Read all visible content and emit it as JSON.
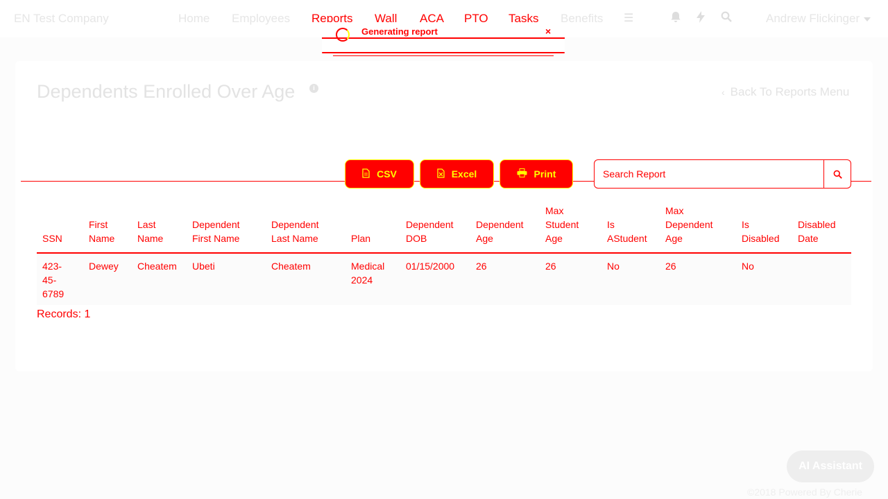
{
  "navbar": {
    "brand": "EN Test Company",
    "links": [
      {
        "label": "Home"
      },
      {
        "label": "Employees"
      },
      {
        "label": "Reports"
      },
      {
        "label": "Wall"
      },
      {
        "label": "ACA"
      },
      {
        "label": "PTO"
      },
      {
        "label": "Tasks"
      },
      {
        "label": "Benefits"
      }
    ],
    "icons": [
      "menu-icon",
      "bell-icon",
      "lightning-icon",
      "search-icon"
    ],
    "user_name": "Andrew Flickinger"
  },
  "toast": {
    "title": "Generating report",
    "close": "×"
  },
  "page": {
    "title": "Dependents Enrolled Over Age",
    "back_link": "Back To Reports Menu"
  },
  "toolbar": {
    "csv_label": "CSV",
    "excel_label": "Excel",
    "print_label": "Print",
    "search_placeholder": "Search Report"
  },
  "table": {
    "headers": [
      [
        "SSN"
      ],
      [
        "First",
        "Name"
      ],
      [
        "Last",
        "Name"
      ],
      [
        "Dependent",
        "First Name"
      ],
      [
        "Dependent",
        "Last Name"
      ],
      [
        "Plan"
      ],
      [
        "Dependent",
        "DOB"
      ],
      [
        "Dependent",
        "Age"
      ],
      [
        "Max",
        "Student",
        "Age"
      ],
      [
        "Is",
        "AStudent"
      ],
      [
        "Max",
        "Dependent",
        "Age"
      ],
      [
        "Is",
        "Disabled"
      ],
      [
        "Disabled",
        "Date"
      ]
    ],
    "rows": [
      {
        "ssn": [
          "423-",
          "45-",
          "6789"
        ],
        "first_name": "Dewey",
        "last_name": "Cheatem",
        "dependent_first_name": "Ubeti",
        "dependent_last_name": "Cheatem",
        "plan": [
          "Medical",
          "2024"
        ],
        "dependent_dob": "01/15/2000",
        "dependent_age": "26",
        "max_student_age": "26",
        "is_student": "No",
        "max_dependent_age": "26",
        "is_disabled": "No",
        "disabled_date": ""
      }
    ]
  },
  "records_label": "Records: 1",
  "ai_assistant_label": "AI Assistant",
  "footer": "©2018 Powered By Cherie"
}
